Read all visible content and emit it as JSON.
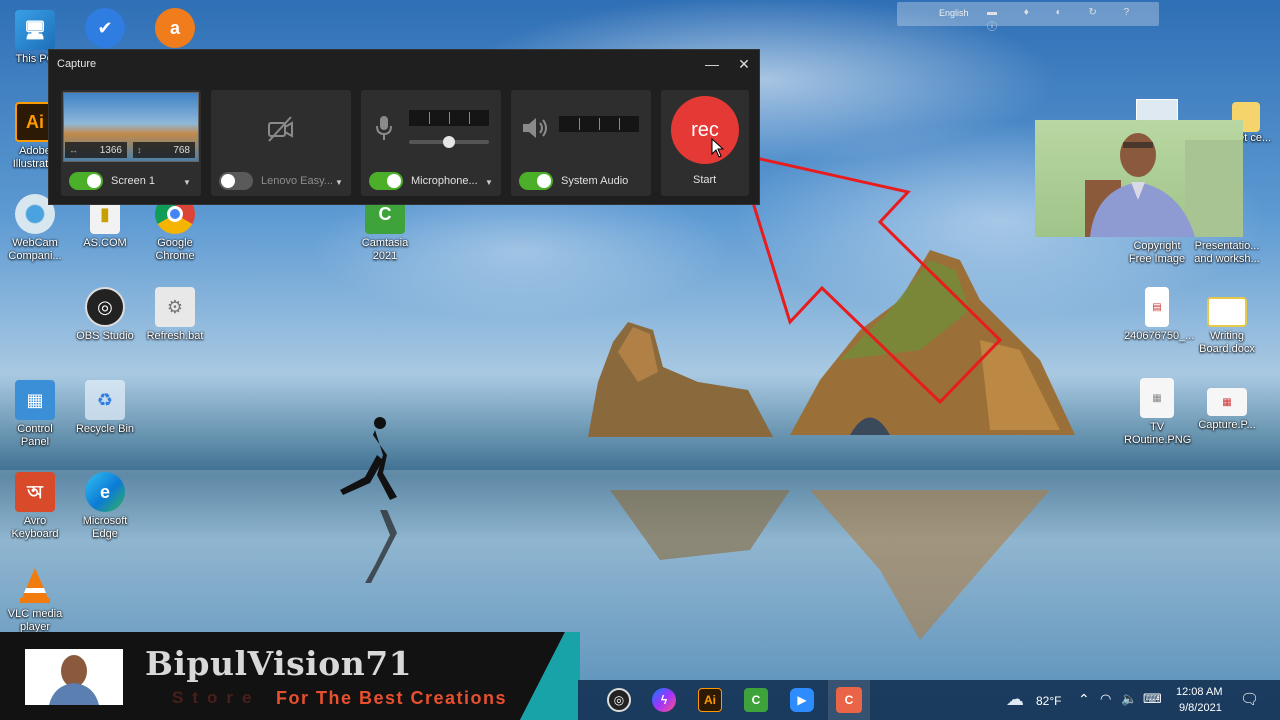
{
  "capture_window": {
    "title": "Capture",
    "minimize_icon": "minimize-icon",
    "close_icon": "close-icon",
    "screen": {
      "width": "1366",
      "height": "768",
      "label": "Screen 1",
      "enabled": true
    },
    "camera": {
      "label": "Lenovo Easy...",
      "enabled": false,
      "icon": "camera-off-icon"
    },
    "microphone": {
      "label": "Microphone...",
      "enabled": true,
      "icon": "microphone-icon",
      "level": 0.5
    },
    "system_audio": {
      "label": "System Audio",
      "enabled": true,
      "icon": "speaker-icon"
    },
    "record": {
      "button_text": "rec",
      "label": "Start",
      "color": "#e53935"
    }
  },
  "desktop_icons": [
    {
      "label": "This PC",
      "icon": "computer-icon"
    },
    {
      "label": "Adobe Illustrat...",
      "icon": "illustrator-icon"
    },
    {
      "label": "WebCam Compani...",
      "icon": "webcam-icon"
    },
    {
      "label": "AS.COM",
      "icon": "file-icon"
    },
    {
      "label": "Google Chrome",
      "icon": "chrome-icon"
    },
    {
      "label": "Camtasia 2021",
      "icon": "camtasia-icon"
    },
    {
      "label": "OBS Studio",
      "icon": "obs-icon"
    },
    {
      "label": "Refresh.bat",
      "icon": "batch-file-icon"
    },
    {
      "label": "Control Panel",
      "icon": "control-panel-icon"
    },
    {
      "label": "Recycle Bin",
      "icon": "recycle-bin-icon"
    },
    {
      "label": "Avro Keyboard",
      "icon": "avro-keyboard-icon"
    },
    {
      "label": "Microsoft Edge",
      "icon": "edge-icon"
    },
    {
      "label": "VLC media player",
      "icon": "vlc-icon"
    },
    {
      "label": "Copyright Free Image",
      "icon": "image-icon"
    },
    {
      "label": "Presentatio... and worksh...",
      "icon": "folder-icon"
    },
    {
      "label": "240676750_...",
      "icon": "document-icon"
    },
    {
      "label": "Writing Board.docx",
      "icon": "word-doc-icon"
    },
    {
      "label": "TV ROutine.PNG",
      "icon": "png-file-icon"
    },
    {
      "label": "Capture.P...",
      "icon": "png-file-icon"
    },
    {
      "label": "eet ce...",
      "icon": "folder-icon"
    }
  ],
  "top_bar": {
    "language": "English"
  },
  "banner": {
    "title": "BipulVision71",
    "tagline_prefix": "Store",
    "tagline": "For The Best Creations"
  },
  "taskbar": {
    "weather": "82°F",
    "time": "12:08 AM",
    "date": "9/8/2021",
    "apps": [
      "obs-icon",
      "messenger-icon",
      "illustrator-icon",
      "camtasia-icon",
      "zoom-icon",
      "camtasia-recorder-icon"
    ]
  }
}
